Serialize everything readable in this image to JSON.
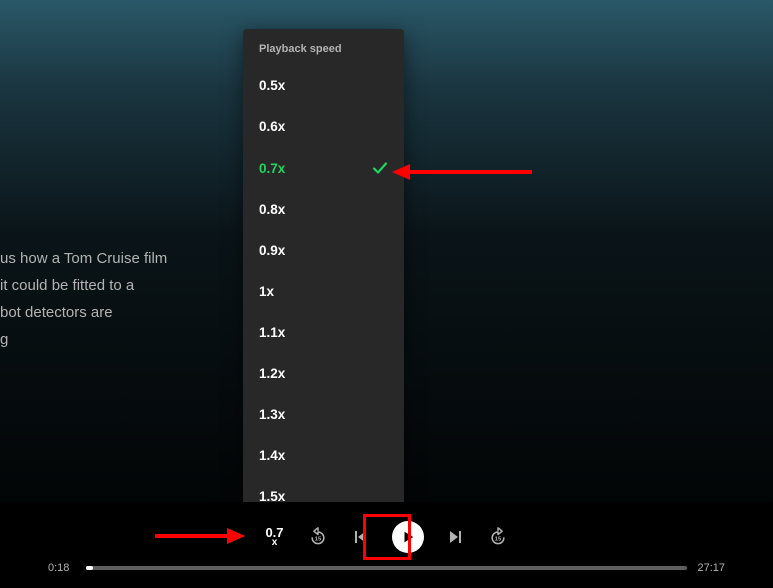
{
  "content_lines": [
    "us how a Tom Cruise film",
    "it could be fitted to a",
    "bot detectors are",
    "g"
  ],
  "playback_menu": {
    "header": "Playback speed",
    "options": [
      {
        "label": "0.5x",
        "selected": false
      },
      {
        "label": "0.6x",
        "selected": false
      },
      {
        "label": "0.7x",
        "selected": true
      },
      {
        "label": "0.8x",
        "selected": false
      },
      {
        "label": "0.9x",
        "selected": false
      },
      {
        "label": "1x",
        "selected": false
      },
      {
        "label": "1.1x",
        "selected": false
      },
      {
        "label": "1.2x",
        "selected": false
      },
      {
        "label": "1.3x",
        "selected": false
      },
      {
        "label": "1.4x",
        "selected": false
      },
      {
        "label": "1.5x",
        "selected": false
      }
    ]
  },
  "player": {
    "speed_value": "0.7",
    "speed_suffix": "x",
    "elapsed": "0:18",
    "duration": "27:17"
  },
  "annotations": {
    "arrow1": "red-arrow",
    "arrow2": "red-arrow",
    "play_highlight": "red-box"
  }
}
